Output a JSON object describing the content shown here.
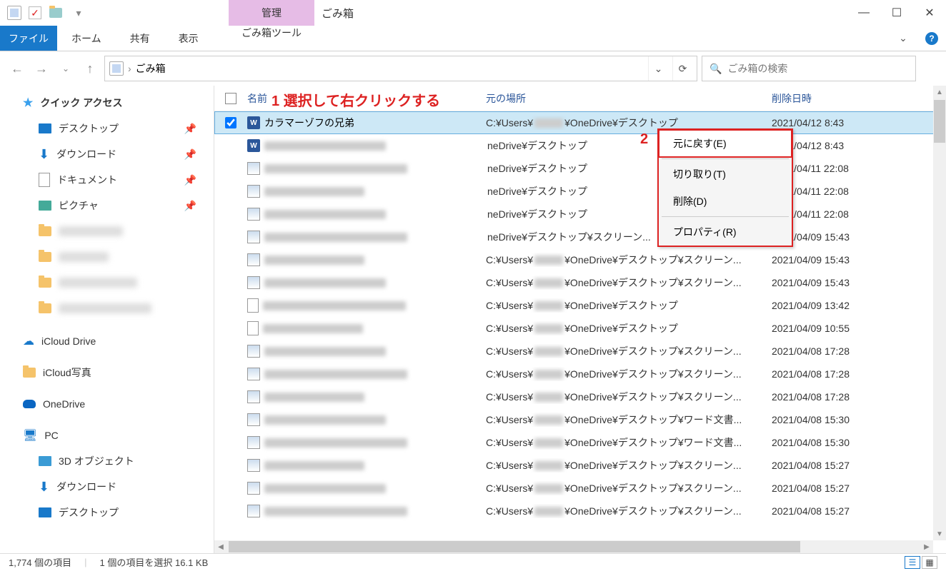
{
  "window": {
    "manage_label": "管理",
    "title": "ごみ箱"
  },
  "ribbon": {
    "file": "ファイル",
    "home": "ホーム",
    "share": "共有",
    "view": "表示",
    "tools": "ごみ箱ツール"
  },
  "address": {
    "path": "ごみ箱",
    "placeholder": "ごみ箱の検索"
  },
  "columns": {
    "name": "名前",
    "location": "元の場所",
    "deleted": "削除日時"
  },
  "annotations": {
    "a1": "1 選択して右クリックする",
    "a2": "2"
  },
  "context_menu": {
    "restore": "元に戻す(E)",
    "cut": "切り取り(T)",
    "delete": "削除(D)",
    "properties": "プロパティ(R)"
  },
  "sidebar": {
    "quick_access": "クイック アクセス",
    "desktop": "デスクトップ",
    "downloads": "ダウンロード",
    "documents": "ドキュメント",
    "pictures": "ピクチャ",
    "icloud_drive": "iCloud Drive",
    "icloud_photos": "iCloud写真",
    "onedrive": "OneDrive",
    "pc": "PC",
    "objects3d": "3D オブジェクト"
  },
  "files": [
    {
      "type": "word",
      "name": "カラマーゾフの兄弟",
      "loc_pre": "C:¥Users¥",
      "loc_post": "¥OneDrive¥デスクトップ",
      "date": "2021/04/12 8:43",
      "selected": true,
      "blur_name": false,
      "blur_loc_mid": true
    },
    {
      "type": "word",
      "loc_post": "neDrive¥デスクトップ",
      "date": "2021/04/12 8:43"
    },
    {
      "type": "img",
      "loc_post": "neDrive¥デスクトップ",
      "date": "2021/04/11 22:08"
    },
    {
      "type": "img",
      "loc_post": "neDrive¥デスクトップ",
      "date": "2021/04/11 22:08"
    },
    {
      "type": "img",
      "loc_post": "neDrive¥デスクトップ",
      "date": "2021/04/11 22:08"
    },
    {
      "type": "img",
      "loc_pre": "",
      "loc_post": "neDrive¥デスクトップ¥スクリーン...",
      "date": "2021/04/09 15:43"
    },
    {
      "type": "img",
      "loc_pre": "C:¥Users¥",
      "loc_post": "¥OneDrive¥デスクトップ¥スクリーン...",
      "date": "2021/04/09 15:43",
      "blur_loc_mid": true
    },
    {
      "type": "img",
      "loc_pre": "C:¥Users¥",
      "loc_post": "¥OneDrive¥デスクトップ¥スクリーン...",
      "date": "2021/04/09 15:43",
      "blur_loc_mid": true
    },
    {
      "type": "doc",
      "loc_pre": "C:¥Users¥",
      "loc_post": "¥OneDrive¥デスクトップ",
      "date": "2021/04/09 13:42",
      "blur_loc_mid": true
    },
    {
      "type": "doc",
      "loc_pre": "C:¥Users¥",
      "loc_post": "¥OneDrive¥デスクトップ",
      "date": "2021/04/09 10:55",
      "blur_loc_mid": true
    },
    {
      "type": "img",
      "loc_pre": "C:¥Users¥",
      "loc_post": "¥OneDrive¥デスクトップ¥スクリーン...",
      "date": "2021/04/08 17:28",
      "blur_loc_mid": true
    },
    {
      "type": "img",
      "loc_pre": "C:¥Users¥",
      "loc_post": "¥OneDrive¥デスクトップ¥スクリーン...",
      "date": "2021/04/08 17:28",
      "blur_loc_mid": true
    },
    {
      "type": "img",
      "loc_pre": "C:¥Users¥",
      "loc_post": "¥OneDrive¥デスクトップ¥スクリーン...",
      "date": "2021/04/08 17:28",
      "blur_loc_mid": true
    },
    {
      "type": "img",
      "loc_pre": "C:¥Users¥",
      "loc_post": "¥OneDrive¥デスクトップ¥ワード文書...",
      "date": "2021/04/08 15:30",
      "blur_loc_mid": true
    },
    {
      "type": "img",
      "loc_pre": "C:¥Users¥",
      "loc_post": "¥OneDrive¥デスクトップ¥ワード文書...",
      "date": "2021/04/08 15:30",
      "blur_loc_mid": true
    },
    {
      "type": "img",
      "loc_pre": "C:¥Users¥",
      "loc_post": "¥OneDrive¥デスクトップ¥スクリーン...",
      "date": "2021/04/08 15:27",
      "blur_loc_mid": true
    },
    {
      "type": "img",
      "loc_pre": "C:¥Users¥",
      "loc_post": "¥OneDrive¥デスクトップ¥スクリーン...",
      "date": "2021/04/08 15:27",
      "blur_loc_mid": true
    },
    {
      "type": "img",
      "loc_pre": "C:¥Users¥",
      "loc_post": "¥OneDrive¥デスクトップ¥スクリーン...",
      "date": "2021/04/08 15:27",
      "blur_loc_mid": true
    }
  ],
  "status": {
    "count": "1,774 個の項目",
    "selected": "1 個の項目を選択 16.1 KB"
  }
}
